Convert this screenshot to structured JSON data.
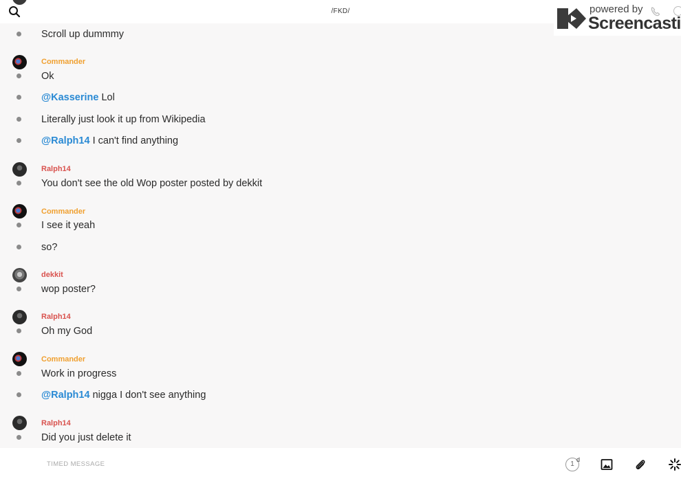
{
  "header": {
    "title": "/FKD/"
  },
  "watermark": {
    "powered_by": "powered by",
    "brand": "Screencastify"
  },
  "messages": [
    {
      "text": "Scroll up dummmy"
    },
    {
      "author": "Commander",
      "text": "Ok"
    },
    {
      "mention": "@Kasserine",
      "text": " Lol"
    },
    {
      "text": "Literally just look it up from Wikipedia"
    },
    {
      "mention": "@Ralph14",
      "text": " I can't find anything"
    },
    {
      "author": "Ralph14",
      "text": "You don't see the old Wop poster posted by dekkit"
    },
    {
      "author": "Commander",
      "text": "I see it yeah"
    },
    {
      "text": "so?"
    },
    {
      "author": "dekkit",
      "text": "wop poster?"
    },
    {
      "author": "Ralph14",
      "text": "Oh my God"
    },
    {
      "author": "Commander",
      "text": "Work in progress"
    },
    {
      "mention": "@Ralph14",
      "text": " nigga I don't see anything"
    },
    {
      "author": "Ralph14",
      "text": "Did you just delete it"
    }
  ],
  "composer": {
    "placeholder": "TIMED MESSAGE",
    "timer_value": "1",
    "timer_unit": "d"
  },
  "colors": {
    "commander_name": "#f0a030",
    "ralph_name": "#d9534f",
    "dekkit_name": "#d9534f",
    "mention": "#2a8ad4"
  }
}
